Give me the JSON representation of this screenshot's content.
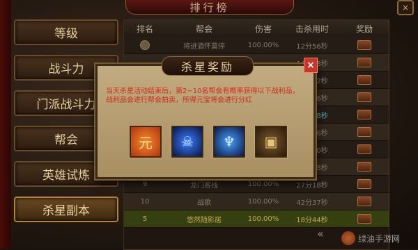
{
  "window": {
    "title": "排行榜",
    "close_label": "×"
  },
  "sidebar": {
    "items": [
      {
        "label": "等级"
      },
      {
        "label": "战斗力"
      },
      {
        "label": "门派战斗力"
      },
      {
        "label": "帮会"
      },
      {
        "label": "英雄试炼"
      },
      {
        "label": "杀星副本"
      }
    ],
    "active_index": 5
  },
  "table": {
    "headers": [
      "排名",
      "帮会",
      "伤害",
      "击杀用时",
      "奖励"
    ],
    "rows": [
      {
        "rank": "",
        "guild": "将进酒怀莫停",
        "damage": "100.00%",
        "time": "12分56秒"
      },
      {
        "rank": "",
        "guild": "",
        "damage": "",
        "time": "14分18秒"
      },
      {
        "rank": "",
        "guild": "",
        "damage": "",
        "time": "15分12秒"
      },
      {
        "rank": "",
        "guild": "",
        "damage": "",
        "time": "16分36秒"
      },
      {
        "rank": "",
        "guild": "",
        "damage": "",
        "time": "16分48秒"
      },
      {
        "rank": "",
        "guild": "",
        "damage": "",
        "time": "18分56秒"
      },
      {
        "rank": "",
        "guild": "",
        "damage": "",
        "time": "19分30秒"
      },
      {
        "rank": "",
        "guild": "",
        "damage": "",
        "time": "24分18秒"
      },
      {
        "rank": "9",
        "guild": "龙门客栈",
        "damage": "100.00%",
        "time": "27分18秒"
      },
      {
        "rank": "10",
        "guild": "战歌",
        "damage": "100.00%",
        "time": "42分37秒"
      },
      {
        "rank": "5",
        "guild": "悠然随影居",
        "damage": "100.00%",
        "time": "18分44秒"
      }
    ]
  },
  "modal": {
    "title": "杀星奖励",
    "close_label": "×",
    "text": "当天杀星活动结束后，第2~10名帮会有概率获得以下战利品，战利品会进行帮会拍卖，所得元宝将会进行分红",
    "rewards": [
      {
        "icon": "coin-icon",
        "glyph": "元"
      },
      {
        "icon": "warrior-icon",
        "glyph": "☠"
      },
      {
        "icon": "mage-icon",
        "glyph": "♆"
      },
      {
        "icon": "chest-icon",
        "glyph": "▣"
      }
    ]
  },
  "pager": {
    "prev": "«",
    "next": "»"
  },
  "watermark": {
    "text": "绿油手游网"
  }
}
